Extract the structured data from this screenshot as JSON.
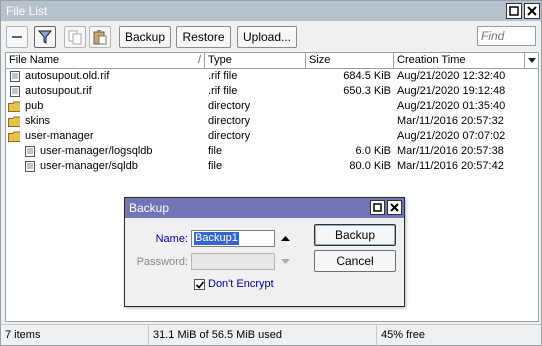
{
  "window": {
    "title": "File List"
  },
  "toolbar": {
    "backup_label": "Backup",
    "restore_label": "Restore",
    "upload_label": "Upload...",
    "find_placeholder": "Find"
  },
  "table": {
    "columns": [
      "File Name",
      "Type",
      "Size",
      "Creation Time"
    ],
    "rows": [
      {
        "name": "autosupout.old.rif",
        "type": ".rif file",
        "size": "684.5 KiB",
        "date": "Aug/21/2020 12:32:40",
        "icon": "file-icon"
      },
      {
        "name": "autosupout.rif",
        "type": ".rif file",
        "size": "650.3 KiB",
        "date": "Aug/21/2020 19:12:48",
        "icon": "file-icon"
      },
      {
        "name": "pub",
        "type": "directory",
        "size": "",
        "date": "Aug/21/2020 01:35:40",
        "icon": "folder-icon"
      },
      {
        "name": "skins",
        "type": "directory",
        "size": "",
        "date": "Mar/11/2016 20:57:32",
        "icon": "folder-icon"
      },
      {
        "name": "user-manager",
        "type": "directory",
        "size": "",
        "date": "Aug/21/2020 07:07:02",
        "icon": "folder-icon"
      },
      {
        "name": "user-manager/logsqldb",
        "type": "file",
        "size": "6.0 KiB",
        "date": "Mar/11/2016 20:57:38",
        "icon": "file-icon"
      },
      {
        "name": "user-manager/sqldb",
        "type": "file",
        "size": "80.0 KiB",
        "date": "Mar/11/2016 20:57:42",
        "icon": "file-icon"
      }
    ]
  },
  "status": {
    "items": "7 items",
    "usage": "31.1 MiB of 56.5 MiB used",
    "free": "45% free"
  },
  "dialog": {
    "title": "Backup",
    "name_label": "Name:",
    "name_value": "Backup1",
    "password_label": "Password:",
    "encrypt_label": "Don't Encrypt",
    "encrypt_checked": true,
    "backup_button": "Backup",
    "cancel_button": "Cancel"
  },
  "colors": {
    "titlebar": "#b7c1cd",
    "dialog_titlebar": "#7175b5",
    "selection": "#3366cc",
    "link_label": "#0000aa",
    "folder": "#e8c14a"
  }
}
